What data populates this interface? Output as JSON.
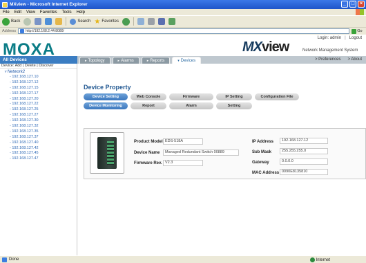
{
  "window": {
    "title": "MXview - Microsoft Internet Explorer",
    "min": "_",
    "max": "□",
    "close": "×"
  },
  "menu": [
    "File",
    "Edit",
    "View",
    "Favorites",
    "Tools",
    "Help"
  ],
  "toolbar": {
    "back": "Back",
    "search": "Search",
    "favorites": "Favorites"
  },
  "address": {
    "label": "Address",
    "url": "http://192.168.2.44:8080/",
    "go": "Go"
  },
  "header": {
    "logo": "MOXA",
    "brand_mx": "MX",
    "brand_view": "view",
    "brand_sub": "Network Management System",
    "login": "Login: admin",
    "logout": "Logout",
    "preferences": "> Preferences",
    "about": "> About"
  },
  "nav": {
    "all_devices": "All Devices",
    "tabs": [
      {
        "label": "Topology",
        "active": false
      },
      {
        "label": "Alarms",
        "active": false
      },
      {
        "label": "Reports",
        "active": false
      },
      {
        "label": "Devices",
        "active": true
      }
    ]
  },
  "sidebar": {
    "actions": "Device: Add | Delete | Discover",
    "root": "Network2",
    "devices": [
      "192.168.127.10",
      "192.168.127.12",
      "192.168.127.15",
      "192.168.127.17",
      "192.168.127.20",
      "192.168.127.22",
      "192.168.127.25",
      "192.168.127.27",
      "192.168.127.30",
      "192.168.127.32",
      "192.168.127.35",
      "192.168.127.37",
      "192.168.127.40",
      "192.168.127.42",
      "192.168.127.45",
      "192.168.127.47"
    ]
  },
  "content": {
    "title": "Device Property",
    "row1": [
      {
        "label": "Device Setting",
        "active": true
      },
      {
        "label": "Web Console",
        "active": false
      },
      {
        "label": "Firmware",
        "active": false
      },
      {
        "label": "IP Setting",
        "active": false
      },
      {
        "label": "Configuration File",
        "active": false
      }
    ],
    "row2": [
      {
        "label": "Device Monitoring",
        "active": true
      },
      {
        "label": "Report",
        "active": false
      },
      {
        "label": "Alarm",
        "active": false
      },
      {
        "label": "Setting",
        "active": false
      }
    ],
    "properties_left": [
      {
        "label": "Product Model",
        "value": "EDS-518A"
      },
      {
        "label": "Device Name",
        "value": "Managed Redundant Switch 00889"
      },
      {
        "label": "Firmware Rev.",
        "value": "V2.3"
      }
    ],
    "properties_right": [
      {
        "label": "IP Address",
        "value": "192.168.127.12"
      },
      {
        "label": "Sub Mask",
        "value": "255.255.255.0"
      },
      {
        "label": "Gateway",
        "value": "0.0.0.0"
      },
      {
        "label": "MAC Address",
        "value": "0090E8135810"
      }
    ]
  },
  "status": {
    "left": "Done",
    "right": "Internet"
  },
  "colors": {
    "accent": "#3b7dc2",
    "logo": "#0a7c86",
    "title_bar": "#1f55c9"
  }
}
